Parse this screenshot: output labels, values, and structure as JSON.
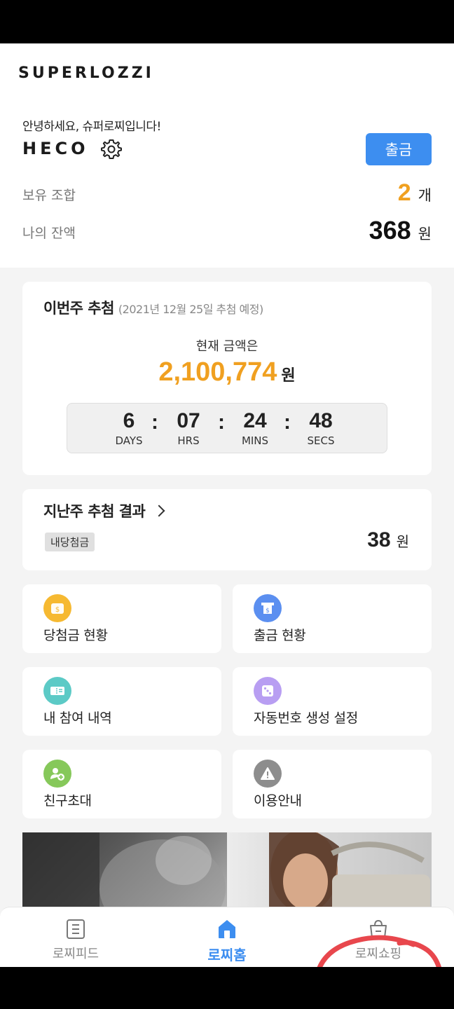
{
  "header": {
    "logo": "SUPERLOZZI",
    "greeting": "안녕하세요, 슈퍼로찌입니다!",
    "username": "HECO",
    "withdraw_label": "출금",
    "combos_label": "보유 조합",
    "combos_value": "2",
    "combos_unit": "개",
    "balance_label": "나의 잔액",
    "balance_value": "368",
    "balance_unit": "원"
  },
  "draw": {
    "title": "이번주 추첨",
    "subtitle": "(2021년 12월 25일 추첨 예정)",
    "current_label": "현재 금액은",
    "amount": "2,100,774",
    "unit": "원",
    "countdown": [
      {
        "value": "6",
        "label": "DAYS"
      },
      {
        "value": "07",
        "label": "HRS"
      },
      {
        "value": "24",
        "label": "MINS"
      },
      {
        "value": "48",
        "label": "SECS"
      }
    ],
    "separator": ":"
  },
  "last_draw": {
    "title": "지난주 추첨 결과",
    "badge": "내당첨금",
    "amount": "38",
    "unit": "원"
  },
  "menu": [
    {
      "label": "당첨금 현황",
      "icon": "wallet-icon",
      "color": "#f6b931"
    },
    {
      "label": "출금 현황",
      "icon": "atm-icon",
      "color": "#5b8ff0"
    },
    {
      "label": "내 참여 내역",
      "icon": "ticket-icon",
      "color": "#5ccac6"
    },
    {
      "label": "자동번호 생성 설정",
      "icon": "dice-icon",
      "color": "#b89ef2"
    },
    {
      "label": "친구초대",
      "icon": "add-friend-icon",
      "color": "#86c85a"
    },
    {
      "label": "이용안내",
      "icon": "warning-icon",
      "color": "#8d8d8d"
    }
  ],
  "tabs": [
    {
      "label": "로찌피드",
      "icon": "feed-icon"
    },
    {
      "label": "로찌홈",
      "icon": "home-icon"
    },
    {
      "label": "로찌쇼핑",
      "icon": "shopping-bag-icon"
    }
  ],
  "colors": {
    "accent": "#3d8ef0",
    "highlight": "#f0a020",
    "annotation": "#e8474d"
  }
}
